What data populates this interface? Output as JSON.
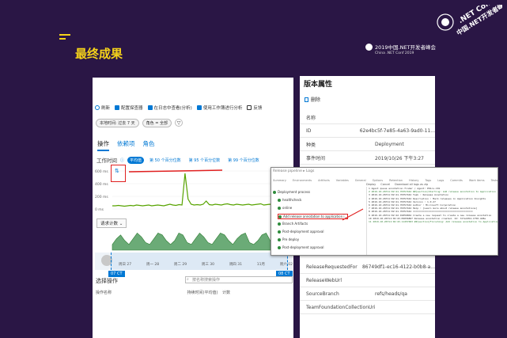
{
  "slide": {
    "title": "最终成果",
    "conference": {
      "line1": "2019中国.NET开发者峰会",
      "line2": "China .NET Conf 2019",
      "badge": ".NET Conf China 2019",
      "badge_sub": "中国.NET开发者峰会"
    }
  },
  "portal": {
    "toolbar": [
      {
        "label": "刷新",
        "icon": "refresh-icon",
        "color": "#0078d4"
      },
      {
        "label": "配置探查器",
        "icon": "settings-icon",
        "color": "#0078d4"
      },
      {
        "label": "在日志中查看(分析)",
        "icon": "logs-icon",
        "color": "#0078d4"
      },
      {
        "label": "使用工作簿进行分析",
        "icon": "workbook-icon",
        "color": "#0078d4"
      },
      {
        "label": "反馈",
        "icon": "feedback-icon",
        "color": "#333"
      }
    ],
    "filters": [
      "本地时间: 过去 7 天",
      "角色 = 全部"
    ],
    "tabs": [
      "操作",
      "依赖项",
      "角色"
    ],
    "metric": {
      "label": "工作时间",
      "chips": [
        "平均值",
        "第 50 个百分位数",
        "第 95 个百分位数",
        "第 99 个百分位数"
      ]
    },
    "chart1_y": [
      "600 ms",
      "400 ms",
      "200 ms",
      "0 ms"
    ],
    "request_dropdown": "请求计数",
    "x_ticks": [
      "周日 27",
      "周一 28",
      "周二 29",
      "周三 30",
      "周四 31",
      "11月",
      "周六 02"
    ],
    "date_tags": [
      "07 CT",
      "08 CT"
    ],
    "section_title": "选择操作",
    "search_placeholder": "按名称搜索操作",
    "table_headers": [
      "操作名称",
      "持续时间(平均值)",
      "计数"
    ],
    "chart1": [
      0.08,
      0.08,
      0.09,
      0.08,
      0.07,
      0.08,
      0.09,
      0.08,
      0.1,
      0.09,
      0.08,
      0.09,
      0.1,
      0.08,
      0.09,
      0.1,
      0.09,
      0.08,
      0.1,
      0.12,
      0.1,
      0.09,
      0.11,
      0.1,
      0.9,
      0.25,
      0.12,
      0.1,
      0.11,
      0.1,
      0.12,
      0.2,
      0.11,
      0.1,
      0.12,
      0.11,
      0.1,
      0.12,
      0.13,
      0.11,
      0.1,
      0.12,
      0.11,
      0.1,
      0.11,
      0.12,
      0.1,
      0.11,
      0.12,
      0.13,
      0.1,
      0.11,
      0.12,
      0.1,
      0.11,
      0.14,
      0.12,
      0.1,
      0.12,
      0.11
    ],
    "chart2": [
      0.3,
      0.6,
      0.8,
      0.5,
      0.3,
      0.6,
      0.9,
      0.7,
      0.4,
      0.3,
      0.6,
      0.9,
      0.8,
      0.5,
      0.3,
      0.5,
      0.9,
      0.8,
      0.4,
      0.3,
      0.6,
      0.9,
      0.7,
      0.4,
      0.3,
      0.6,
      0.9,
      0.8,
      0.5,
      0.3,
      0.6,
      0.8,
      0.9,
      0.4,
      0.3,
      0.5,
      0.8,
      0.9,
      0.5,
      0.3,
      0.6,
      0.9,
      0.8,
      0.4
    ]
  },
  "props": {
    "title": "版本属性",
    "delete_label": "删除",
    "rows": [
      {
        "k": "名称",
        "v": ""
      },
      {
        "k": "ID",
        "v": "62e4bc5f-7e85-4a63-9ad0-11..."
      },
      {
        "k": "种类",
        "v": "Deployment"
      },
      {
        "k": "事件时间",
        "v": "2019/10/26 下午3:27"
      },
      {
        "k": "BuildNumber",
        "v": "2019.10.1026.1"
      },
      {
        "k": "ReleaseRequestedFor",
        "v": "86749df1-ec16-4122-b0b8-a..."
      },
      {
        "k": "ReleaseWebUrl",
        "v": ""
      },
      {
        "k": "SourceBranch",
        "v": "refs/heads/qa"
      },
      {
        "k": "TeamFoundationCollectionUri",
        "v": ""
      }
    ]
  },
  "log": {
    "title": "Release pipeline ▸ Logs",
    "nav": [
      "Summary",
      "Environments",
      "Artifacts",
      "Variables",
      "General",
      "Options",
      "Retention",
      "History",
      "Tags",
      "Logs",
      "Commits",
      "Work items",
      "Tests",
      "Usage",
      "History"
    ],
    "toolbar": [
      "Deploy",
      "Cancel",
      "Download all logs as zip"
    ],
    "tree": [
      {
        "label": "Deployment process",
        "ok": true
      },
      {
        "label": "healthcheck",
        "ok": true
      },
      {
        "label": "online",
        "ok": true
      },
      {
        "label": "Add release annotation to application i...",
        "ok": true,
        "highlight": true
      },
      {
        "label": "Branch Artifacts",
        "ok": true
      },
      {
        "label": "Post-deployment approval",
        "ok": true
      },
      {
        "label": "Pre deploy",
        "ok": true
      },
      {
        "label": "Post-deployment approval",
        "ok": true
      }
    ],
    "lines": [
      "Agent queue annotation-finder / Agent: P01cs-C01",
      "2019-10-26T11:02:41.70357442 ##[section]Starting: Add release annotation to Application",
      "2019-10-26T11:02:41.70357442 Task     : Release Annotation",
      "2019-10-26T11:02:41.70357442 Description : Mark releases in Application Insights",
      "2019-10-26T11:02:41.70357442 Version    : 1.0.27",
      "2019-10-26T11:02:41.70357442 Author     : Microsoft Corporation",
      "2019-10-26T11:02:41.70357442 Help       : [Learn more about release annotations]",
      "2019-10-26T11:02:41.70357442 ==========================================",
      "2019-10-26T11:02:42.91856862 Create a new request to create a new release annotation",
      "2019-10-26T11:02:43.09056867 Release annotation created. Id: 7d7e1054-1f50-4d8e",
      "2019-10-26T11:02:43.11457063 ##[section]Finishing: Add release annotation to Application"
    ]
  }
}
